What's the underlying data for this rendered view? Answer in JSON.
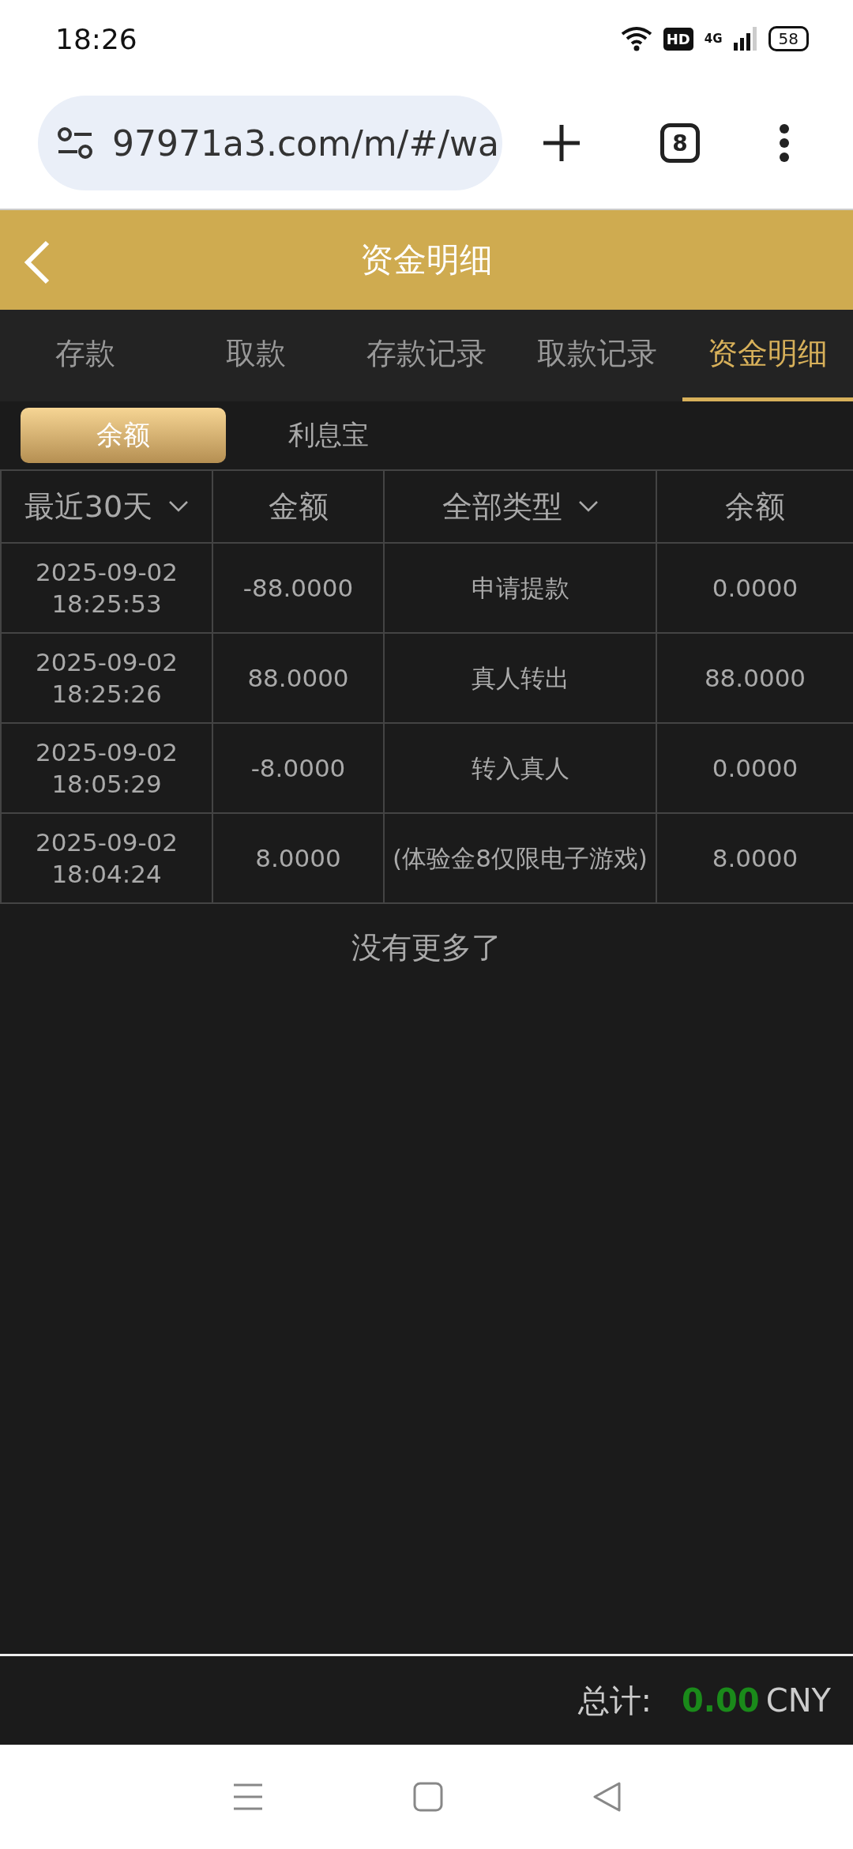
{
  "status_bar": {
    "time": "18:26",
    "battery": "58",
    "network": "4G",
    "hd": "HD"
  },
  "browser": {
    "url": "97971a3.com/m/#/wa",
    "tab_count": "8"
  },
  "header": {
    "title": "资金明细"
  },
  "tabs": [
    {
      "label": "存款",
      "selected": false
    },
    {
      "label": "取款",
      "selected": false
    },
    {
      "label": "存款记录",
      "selected": false
    },
    {
      "label": "取款记录",
      "selected": false
    },
    {
      "label": "资金明细",
      "selected": true
    }
  ],
  "subtabs": [
    {
      "label": "余额",
      "selected": true
    },
    {
      "label": "利息宝",
      "selected": false
    }
  ],
  "table": {
    "columns": [
      {
        "label": "最近30天",
        "dropdown": true
      },
      {
        "label": "金额",
        "dropdown": false
      },
      {
        "label": "全部类型",
        "dropdown": true
      },
      {
        "label": "余额",
        "dropdown": false
      }
    ],
    "rows": [
      {
        "date": "2025-09-02",
        "time": "18:25:53",
        "amount": "-88.0000",
        "type": "申请提款",
        "balance": "0.0000"
      },
      {
        "date": "2025-09-02",
        "time": "18:25:26",
        "amount": "88.0000",
        "type": "真人转出",
        "balance": "88.0000"
      },
      {
        "date": "2025-09-02",
        "time": "18:05:29",
        "amount": "-8.0000",
        "type": "转入真人",
        "balance": "0.0000"
      },
      {
        "date": "2025-09-02",
        "time": "18:04:24",
        "amount": "8.0000",
        "type": "(体验金8仅限电子游戏)",
        "balance": "8.0000"
      }
    ]
  },
  "no_more": "没有更多了",
  "footer": {
    "label": "总计:",
    "total": "0.00",
    "currency": "CNY"
  }
}
